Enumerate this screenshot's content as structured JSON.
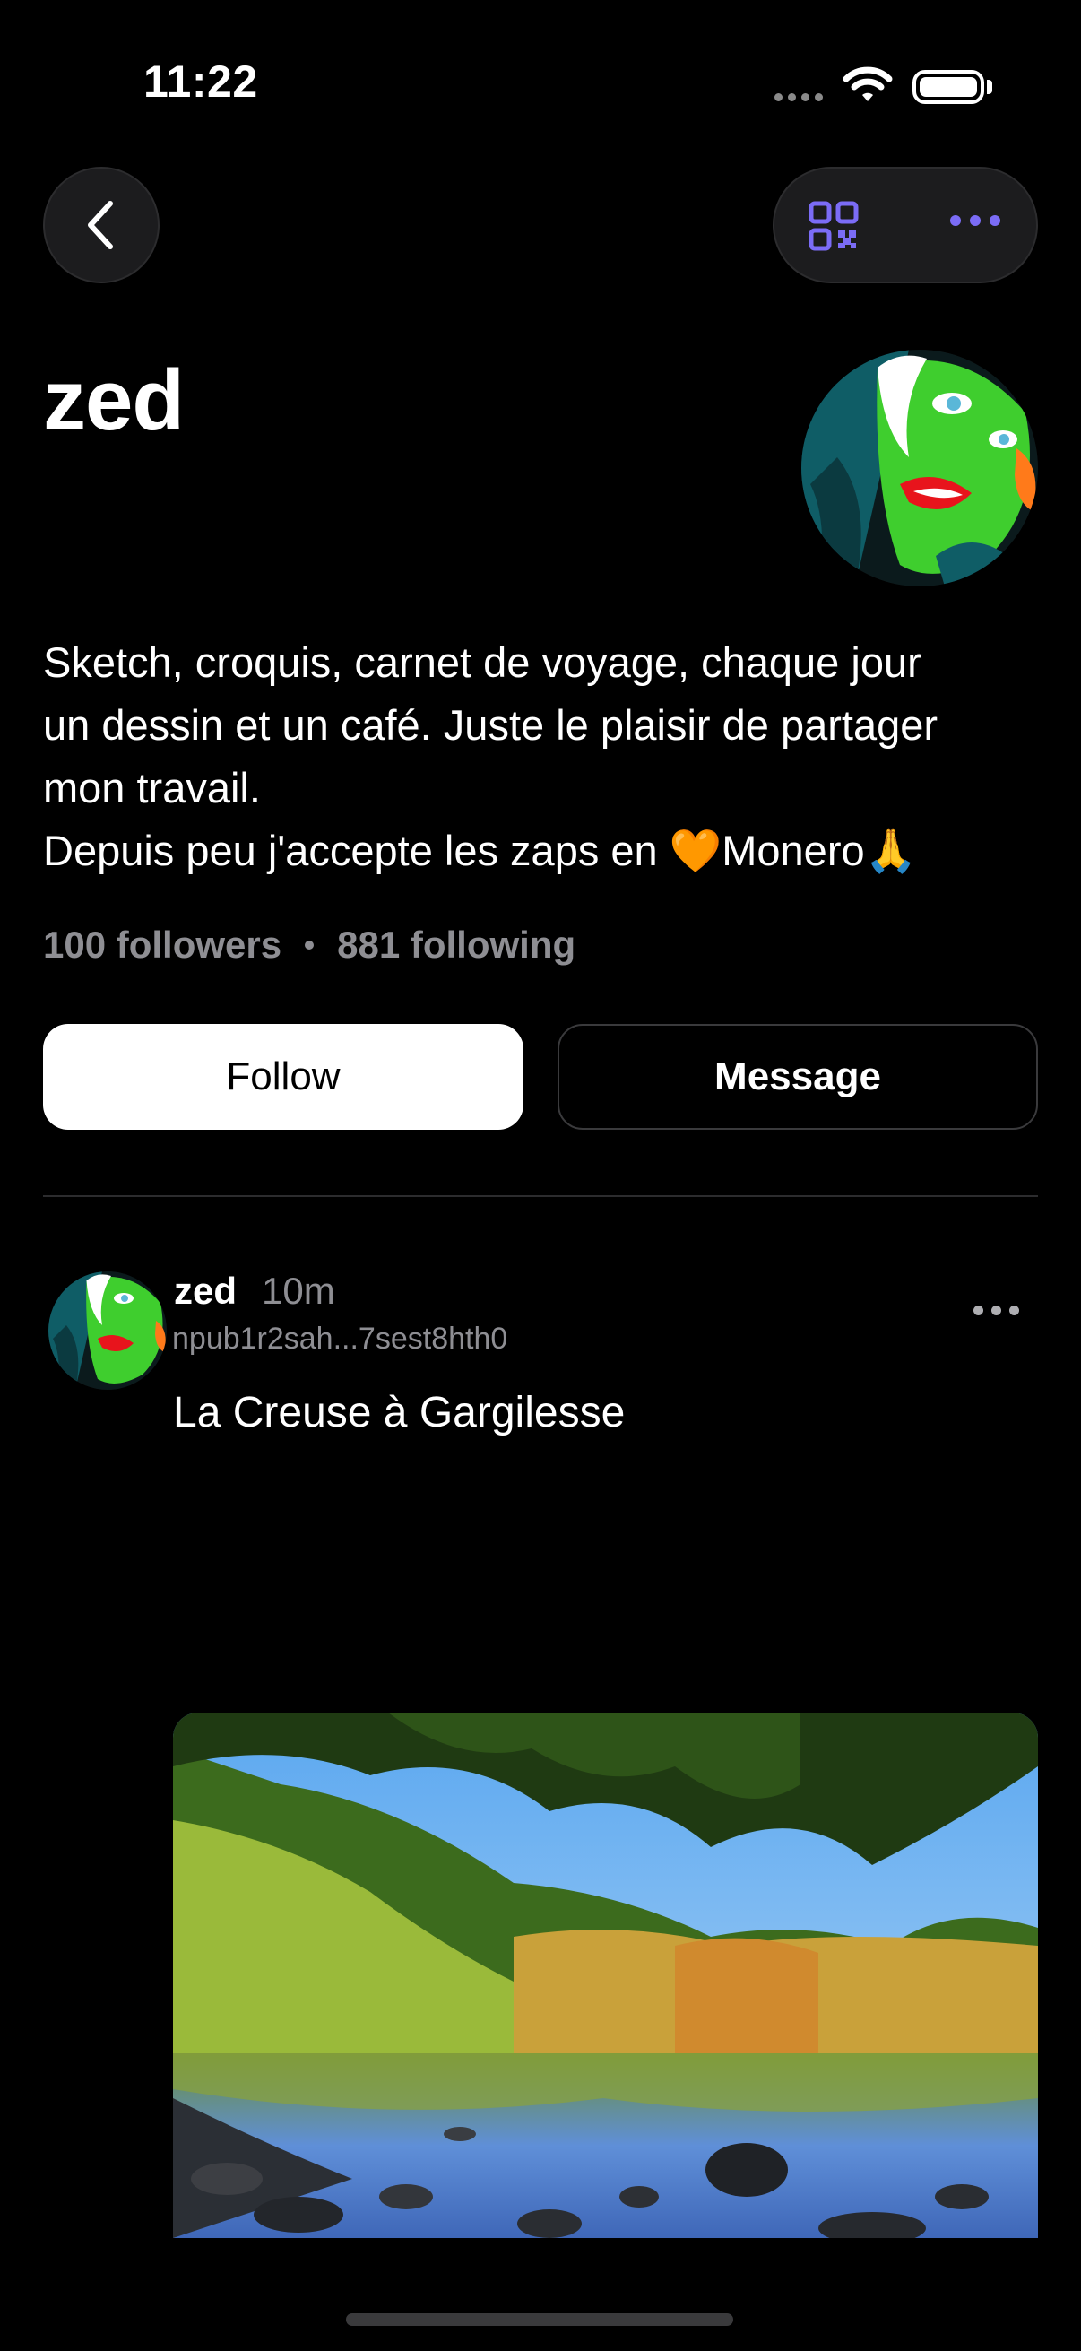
{
  "status_bar": {
    "time": "11:22"
  },
  "nav": {
    "back": "back",
    "qr": "qr-code",
    "more": "more"
  },
  "profile": {
    "name": "zed",
    "bio": "Sketch, croquis, carnet de voyage, chaque jour\nun dessin et un café. Juste le plaisir de partager\nmon travail.\nDepuis peu j'accepte les zaps en 🧡Monero🙏",
    "followers": "100 followers",
    "following": "881 following"
  },
  "actions": {
    "follow_label": "Follow",
    "message_label": "Message"
  },
  "post": {
    "author": "zed",
    "time": "10m",
    "npub": "npub1r2sah...7sest8hth0",
    "text": "La Creuse à Gargilesse"
  },
  "colors": {
    "accent": "#7b6cf6",
    "background": "#000000",
    "secondary_text": "#8e8e93"
  }
}
